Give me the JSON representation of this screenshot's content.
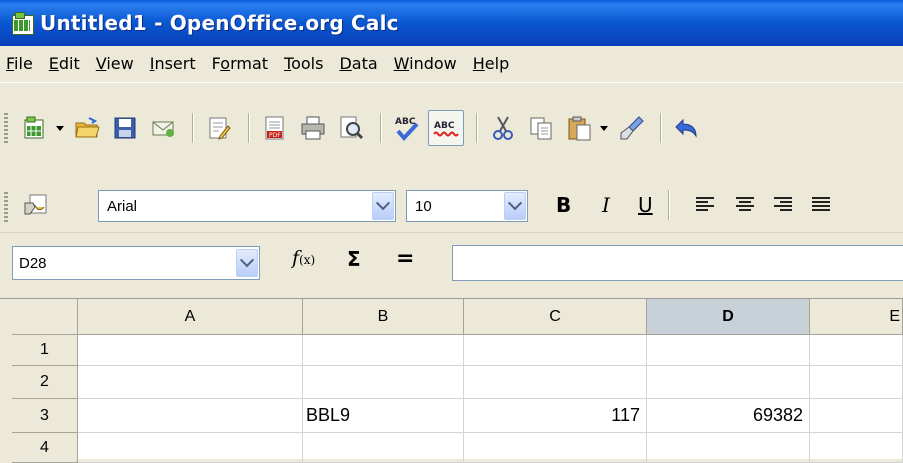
{
  "window": {
    "title": "Untitled1 - OpenOffice.org Calc"
  },
  "menu": [
    {
      "pre": "",
      "key": "F",
      "post": "ile"
    },
    {
      "pre": "",
      "key": "E",
      "post": "dit"
    },
    {
      "pre": "",
      "key": "V",
      "post": "iew"
    },
    {
      "pre": "",
      "key": "I",
      "post": "nsert"
    },
    {
      "pre": "F",
      "key": "o",
      "post": "rmat"
    },
    {
      "pre": "",
      "key": "T",
      "post": "ools"
    },
    {
      "pre": "",
      "key": "D",
      "post": "ata"
    },
    {
      "pre": "",
      "key": "W",
      "post": "indow"
    },
    {
      "pre": "",
      "key": "H",
      "post": "elp"
    }
  ],
  "formatting": {
    "font_name": "Arial",
    "font_size": "10",
    "bold_label": "B",
    "italic_label": "I",
    "underline_label": "U"
  },
  "formula_bar": {
    "name_box": "D28",
    "fx_label": "f(x)",
    "sum_label": "Σ",
    "equals_label": "=",
    "content": ""
  },
  "sheet": {
    "columns": [
      "A",
      "B",
      "C",
      "D",
      "E"
    ],
    "active_column": "D",
    "rows": [
      {
        "label": "1",
        "cells": [
          "",
          "",
          "",
          "",
          ""
        ]
      },
      {
        "label": "2",
        "cells": [
          "",
          "",
          "",
          "",
          ""
        ]
      },
      {
        "label": "3",
        "cells": [
          "",
          "BBL9",
          "117",
          "69382",
          ""
        ]
      },
      {
        "label": "4",
        "cells": [
          "",
          "",
          "",
          "",
          ""
        ]
      }
    ]
  },
  "colors": {
    "titlebar": "#0a57d0",
    "chrome": "#ece9d8",
    "active_header": "#c8d0d8"
  }
}
